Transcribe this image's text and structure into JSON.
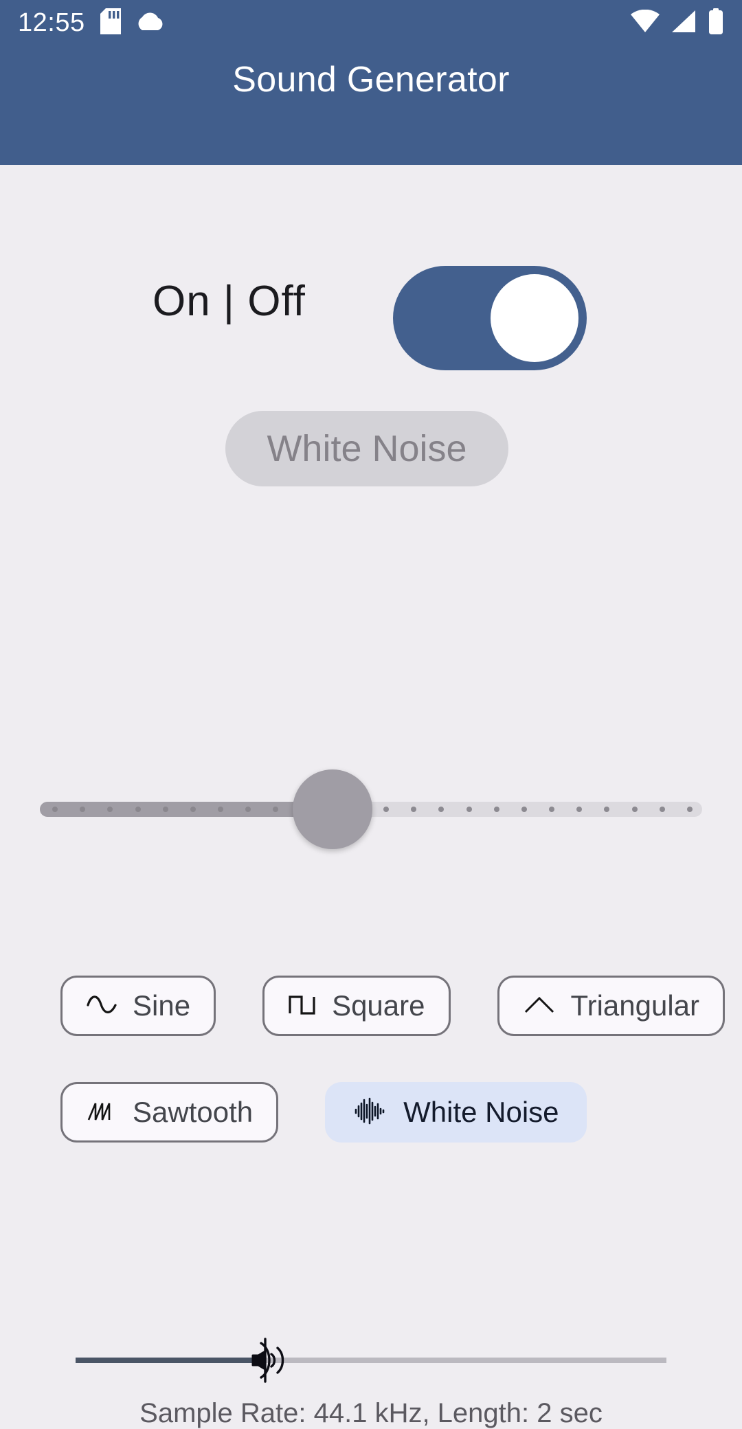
{
  "status_bar": {
    "clock": "12:55",
    "left_icons": [
      "sd-card-icon",
      "cloud-icon"
    ],
    "right_icons": [
      "wifi-icon",
      "cellular-signal-icon",
      "battery-icon"
    ]
  },
  "app_bar": {
    "title": "Sound Generator",
    "background_color": "#415E8C"
  },
  "power": {
    "label": "On | Off",
    "switch_state": "on",
    "switch_color": "#43608E",
    "knob_color": "#FFFFFF"
  },
  "mode_chip": {
    "label": "White Noise",
    "background_color": "#D3D2D7",
    "text_color": "#858289",
    "disabled": true
  },
  "frequency_slider": {
    "fill_color": "#A09DA5",
    "track_color": "#DCDADF",
    "thumb_color": "#A09DA5",
    "fill_percent": 42,
    "tick_count": 24,
    "disabled": true
  },
  "waveforms": {
    "selected": "White Noise",
    "selected_background": "#DCE4F7",
    "row1": [
      {
        "label": "Sine",
        "icon": "sine-wave-icon",
        "selected": false
      },
      {
        "label": "Square",
        "icon": "square-wave-icon",
        "selected": false
      },
      {
        "label": "Triangular",
        "icon": "triangle-wave-icon",
        "selected": false
      }
    ],
    "row2": [
      {
        "label": "Sawtooth",
        "icon": "sawtooth-wave-icon",
        "selected": false
      },
      {
        "label": "White Noise",
        "icon": "noise-wave-icon",
        "selected": true
      }
    ]
  },
  "volume_slider": {
    "fill_percent": 32,
    "fill_color": "#4A5566",
    "track_color": "#BBB9C0",
    "thumb_icon": "speaker-volume-icon"
  },
  "footer": {
    "info": "Sample Rate: 44.1 kHz, Length: 2 sec"
  }
}
